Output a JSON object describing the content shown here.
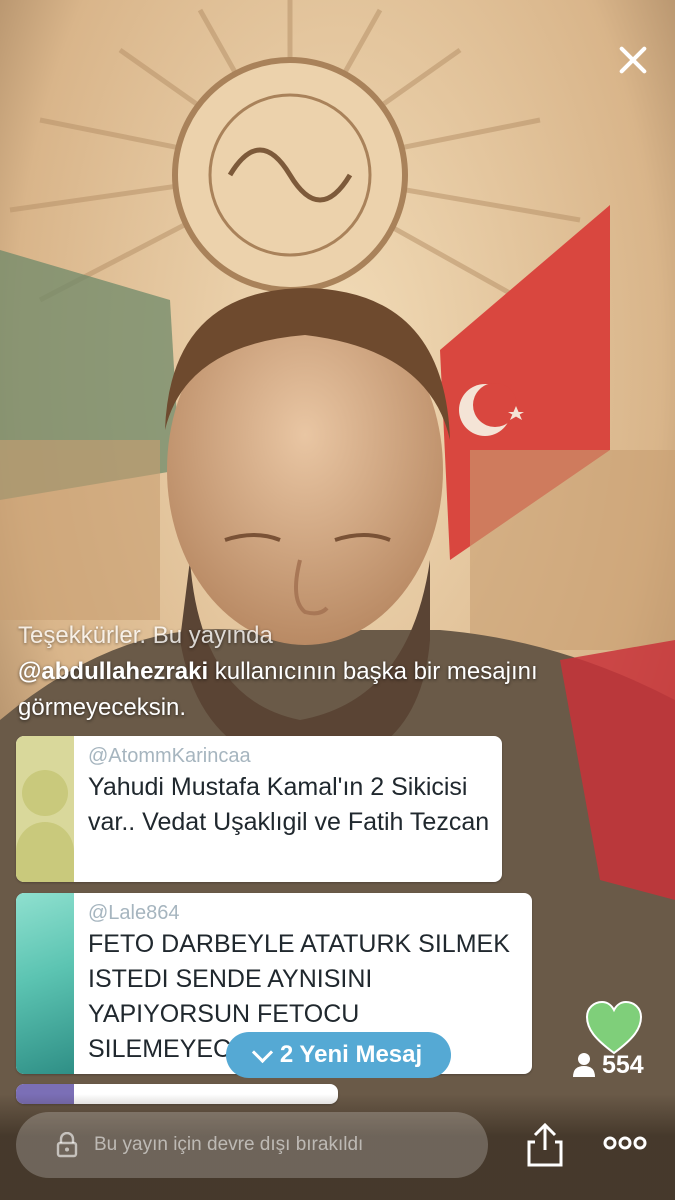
{
  "system_message": {
    "line1": "Teşekkürler. Bu yayında",
    "user": "@abdullahezraki",
    "rest": " kullanıcının başka bir mesajını görmeyeceksin."
  },
  "messages": [
    {
      "handle": "@AtommKarincaa",
      "text": "Yahudi Mustafa Kamal'ın 2 Sikicisi var.. Vedat Uşaklıgil ve Fatih Tezcan"
    },
    {
      "handle": "@Lale864",
      "text": "FETO DARBEYLE ATATURK SILMEK ISTEDI SENDE AYNISINI YAPIYORSUN FETOCU SILEMEYECEK"
    }
  ],
  "new_messages_label": "2 Yeni Mesaj",
  "viewer_count": "554",
  "comment_input": {
    "placeholder": "Bu yayın için devre dışı bırakıldı"
  },
  "icons": {
    "close": "close-icon",
    "heart": "heart-icon",
    "viewers": "person-icon",
    "lock": "lock-icon",
    "share": "share-icon",
    "more": "more-icon"
  },
  "colors": {
    "heart": "#7fcf7a",
    "new_messages": "#55a9d4"
  }
}
